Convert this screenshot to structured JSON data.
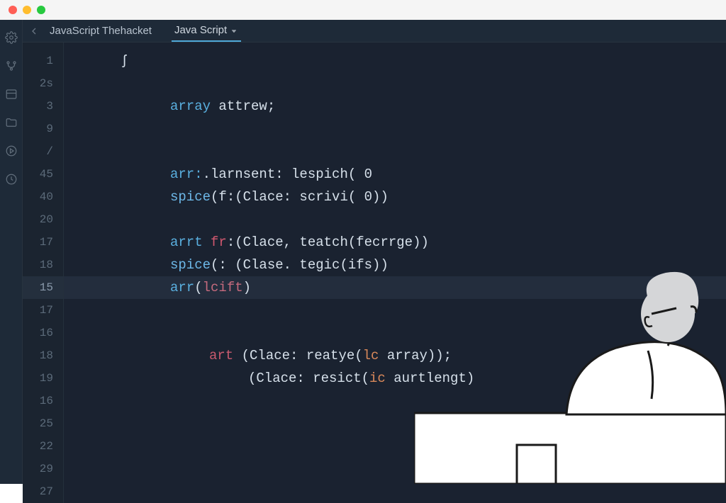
{
  "titlebar": {},
  "tabbar": {
    "breadcrumb": "JavaScript Thehacket",
    "active_tab": "Java Script"
  },
  "gutter_lines": [
    "1",
    "2s",
    "3",
    "9",
    "/",
    "45",
    "40",
    "20",
    "17",
    "18",
    "15",
    "17",
    "16",
    "18",
    "19",
    "16",
    "25",
    "22",
    "29",
    "27"
  ],
  "cursor_line_index": 10,
  "code_lines": [
    {
      "indent": "indent1",
      "tokens": [
        {
          "cls": "tok-punct",
          "t": "ʃ"
        }
      ]
    },
    {
      "indent": "indent1",
      "tokens": []
    },
    {
      "indent": "indent2",
      "tokens": [
        {
          "cls": "tok-keyword",
          "t": "array"
        },
        {
          "cls": "tok-ident",
          "t": " attrew"
        },
        {
          "cls": "tok-punct",
          "t": ";"
        }
      ]
    },
    {
      "indent": "indent2",
      "tokens": []
    },
    {
      "indent": "indent2",
      "tokens": []
    },
    {
      "indent": "indent2",
      "tokens": [
        {
          "cls": "tok-keyword",
          "t": "arr:"
        },
        {
          "cls": "tok-ident",
          "t": ".larnsent: lespich( 0"
        }
      ]
    },
    {
      "indent": "indent2",
      "tokens": [
        {
          "cls": "tok-func",
          "t": "spice"
        },
        {
          "cls": "tok-ident",
          "t": "(f:(Clace: scrivi( 0))"
        }
      ]
    },
    {
      "indent": "indent2",
      "tokens": []
    },
    {
      "indent": "indent2",
      "tokens": [
        {
          "cls": "tok-keyword",
          "t": "arrt "
        },
        {
          "cls": "tok-param",
          "t": "fr"
        },
        {
          "cls": "tok-ident",
          "t": ":(Clace, teatch(fecrrge))"
        }
      ]
    },
    {
      "indent": "indent2",
      "tokens": [
        {
          "cls": "tok-func",
          "t": "spice"
        },
        {
          "cls": "tok-ident",
          "t": "(: (Clase. tegic(ifs))"
        }
      ]
    },
    {
      "indent": "indent2",
      "tokens": [
        {
          "cls": "tok-keyword",
          "t": "arr"
        },
        {
          "cls": "tok-ident",
          "t": "("
        },
        {
          "cls": "tok-param2",
          "t": "lcift"
        },
        {
          "cls": "tok-ident",
          "t": ")"
        }
      ]
    },
    {
      "indent": "indent2",
      "tokens": []
    },
    {
      "indent": "indent2",
      "tokens": []
    },
    {
      "indent": "indent3",
      "tokens": [
        {
          "cls": "tok-redkw",
          "t": "art"
        },
        {
          "cls": "tok-ident",
          "t": " (Clace: reatye("
        },
        {
          "cls": "tok-orange",
          "t": "lc"
        },
        {
          "cls": "tok-ident",
          "t": " array));"
        }
      ]
    },
    {
      "indent": "indent4",
      "tokens": [
        {
          "cls": "tok-ident",
          "t": "(Clace: resict("
        },
        {
          "cls": "tok-orange",
          "t": "ic"
        },
        {
          "cls": "tok-ident",
          "t": " aurtlengt)"
        }
      ]
    },
    {
      "indent": "indent2",
      "tokens": []
    },
    {
      "indent": "indent2",
      "tokens": []
    },
    {
      "indent": "indent2",
      "tokens": []
    },
    {
      "indent": "indent2",
      "tokens": []
    },
    {
      "indent": "indent2",
      "tokens": []
    }
  ]
}
